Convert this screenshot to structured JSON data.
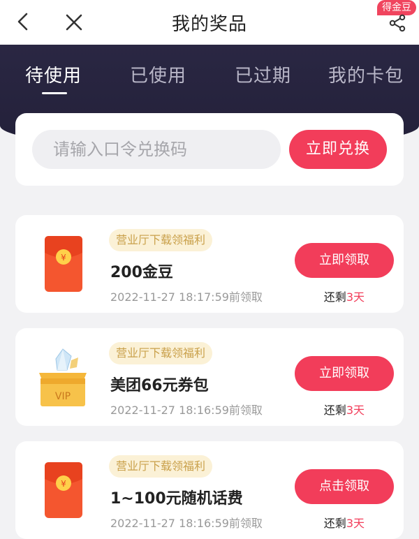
{
  "header": {
    "title": "我的奖品",
    "badge": "得金豆"
  },
  "tabs": [
    {
      "label": "待使用",
      "active": true
    },
    {
      "label": "已使用",
      "active": false
    },
    {
      "label": "已过期",
      "active": false
    },
    {
      "label": "我的卡包",
      "active": false
    }
  ],
  "redeem": {
    "placeholder": "请输入口令兑换码",
    "button": "立即兑换"
  },
  "prizes": [
    {
      "icon": "red-envelope-icon",
      "tag": "营业厅下载领福利",
      "name": "200金豆",
      "date": "2022-11-27 18:17:59前领取",
      "button": "立即领取",
      "remain_prefix": "还剩",
      "remain_days": "3天"
    },
    {
      "icon": "vip-box-icon",
      "tag": "营业厅下载领福利",
      "name": "美团66元券包",
      "date": "2022-11-27 18:16:59前领取",
      "button": "立即领取",
      "remain_prefix": "还剩",
      "remain_days": "3天"
    },
    {
      "icon": "red-envelope-icon",
      "tag": "营业厅下载领福利",
      "name": "1~100元随机话费",
      "date": "2022-11-27 18:16:59前领取",
      "button": "点击领取",
      "remain_prefix": "还剩",
      "remain_days": "3天"
    }
  ],
  "colors": {
    "accent": "#f23d5a",
    "header_dark": "#2a2743",
    "tag_bg": "#fbf1d6",
    "tag_text": "#c9a04a"
  },
  "vip_label": "VIP"
}
